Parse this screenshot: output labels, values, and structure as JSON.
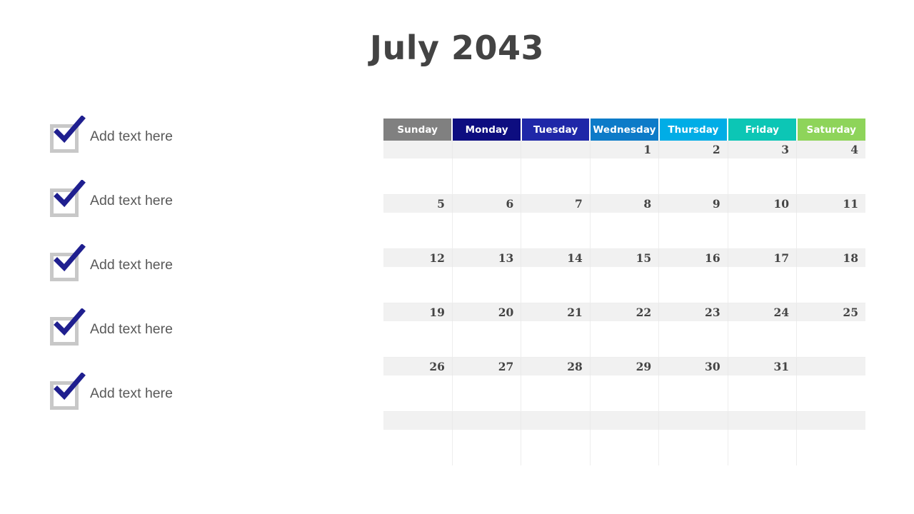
{
  "title": "July 2043",
  "checklist": {
    "items": [
      {
        "label": "Add text here",
        "checked": true
      },
      {
        "label": "Add text here",
        "checked": true
      },
      {
        "label": "Add text here",
        "checked": true
      },
      {
        "label": "Add text here",
        "checked": true
      },
      {
        "label": "Add text here",
        "checked": true
      }
    ],
    "checkmark_color": "#1f1f8f",
    "box_border_color": "#c8c8c8",
    "label_color": "#595959"
  },
  "calendar": {
    "month": "July",
    "year": "2043",
    "weekday_headers": [
      {
        "label": "Sunday",
        "color": "#808080"
      },
      {
        "label": "Monday",
        "color": "#0d0d80"
      },
      {
        "label": "Tuesday",
        "color": "#1f27a8"
      },
      {
        "label": "Wednesday",
        "color": "#0d7bc8"
      },
      {
        "label": "Thursday",
        "color": "#00ade6"
      },
      {
        "label": "Friday",
        "color": "#0cc6b5"
      },
      {
        "label": "Saturday",
        "color": "#8ed45a"
      }
    ],
    "weeks": [
      [
        "",
        "",
        "",
        "1",
        "2",
        "3",
        "4"
      ],
      [
        "5",
        "6",
        "7",
        "8",
        "9",
        "10",
        "11"
      ],
      [
        "12",
        "13",
        "14",
        "15",
        "16",
        "17",
        "18"
      ],
      [
        "19",
        "20",
        "21",
        "22",
        "23",
        "24",
        "25"
      ],
      [
        "26",
        "27",
        "28",
        "29",
        "30",
        "31",
        ""
      ],
      [
        "",
        "",
        "",
        "",
        "",
        "",
        ""
      ]
    ],
    "shaded_row_color": "#f1f1f1",
    "grid_line_color": "#ededed",
    "daynum_color": "#444444"
  }
}
